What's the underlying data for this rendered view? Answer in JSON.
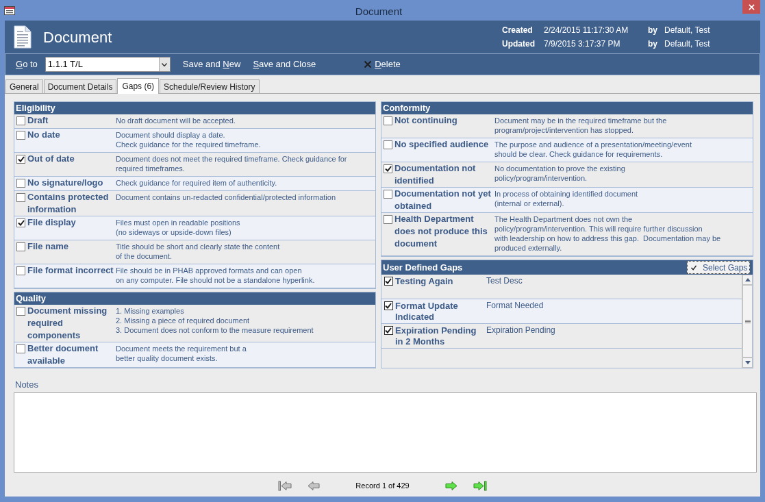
{
  "window": {
    "title": "Document"
  },
  "header": {
    "title": "Document",
    "audit": [
      {
        "label": "Created",
        "date": "2/24/2015 11:17:30 AM",
        "by": "by",
        "user": "Default, Test"
      },
      {
        "label": "Updated",
        "date": "7/9/2015 3:17:37 PM",
        "by": "by",
        "user": "Default, Test"
      }
    ]
  },
  "toolbar": {
    "goto": {
      "key": "G",
      "after": "o to",
      "value": "1.1.1 T/L"
    },
    "buttons": [
      {
        "kind": "plain",
        "before": "Save and ",
        "key": "N",
        "after": "ew"
      },
      {
        "kind": "plain",
        "key": "S",
        "after": "ave and Close"
      },
      {
        "kind": "delete",
        "key": "D",
        "after": "elete"
      }
    ]
  },
  "tabs": [
    {
      "label": "General",
      "selected": false
    },
    {
      "label": "Document Details",
      "selected": false
    },
    {
      "label": "Gaps (6)",
      "selected": true
    },
    {
      "label": "Schedule/Review History",
      "selected": false
    }
  ],
  "left_sections": [
    {
      "title": "Eligibility",
      "items": [
        {
          "label": "Draft",
          "description": "No draft document will be accepted.",
          "checked": false
        },
        {
          "label": "No date",
          "description": "Document should display a date.\nCheck guidance for the required timeframe.",
          "checked": false
        },
        {
          "label": "Out of date",
          "description": "Document does not meet the required timeframe. Check guidance for\nrequired timeframes.",
          "checked": true
        },
        {
          "label": "No signature/logo",
          "description": "Check guidance for required item of authenticity.",
          "checked": false
        },
        {
          "label": "Contains protected information",
          "description": "Document contains un-redacted confidential/protected information",
          "checked": false
        },
        {
          "label": "File display",
          "description": "Files must open in readable positions\n(no sideways or upside-down files)",
          "checked": true
        },
        {
          "label": "File name",
          "description": "Title should be short and clearly state the content\nof the document.",
          "checked": false
        },
        {
          "label": "File format incorrect",
          "description": "File should be in PHAB approved formats and can open\non any computer. File should not be a standalone hyperlink.",
          "checked": false
        }
      ]
    },
    {
      "title": "Quality",
      "items": [
        {
          "label": "Document missing required components",
          "description": "1. Missing examples\n2. Missing a piece of required document\n3. Document does not conform to the measure requirement",
          "checked": false
        },
        {
          "label": "Better document available",
          "description": "Document meets the requirement but a\nbetter quality document exists.",
          "checked": false
        }
      ]
    }
  ],
  "right_sections": [
    {
      "title": "Conformity",
      "items": [
        {
          "label": "Not continuing",
          "description": "Document may be in the required timeframe but the\nprogram/project/intervention has stopped.",
          "checked": false
        },
        {
          "label": "No specified audience",
          "description": "The purpose and audience of a presentation/meeting/event\nshould be clear. Check guidance for requirements.",
          "checked": false
        },
        {
          "label": "Documentation not identified",
          "description": "No documentation to prove the existing\npolicy/program/intervention.",
          "checked": true
        },
        {
          "label": "Documentation not yet obtained",
          "description": "In process of obtaining identified document\n(internal or external).",
          "checked": false
        },
        {
          "label": "Health Department does not produce this document",
          "description": "The Health Department does not own the\npolicy/program/intervention. This will require further discussion\nwith leadership on how to address this gap.  Documentation may be\nproduced externally.",
          "checked": false
        }
      ]
    }
  ],
  "user_defined_gaps": {
    "title": "User Defined Gaps",
    "select_button": "Select Gaps",
    "items": [
      {
        "label": "Testing Again",
        "description": "Test Desc",
        "checked": true
      },
      {
        "label": "Format Update Indicated",
        "description": "Format Needed",
        "checked": true
      },
      {
        "label": "Expiration Pending in 2 Months",
        "description": "Expiration Pending",
        "checked": true
      }
    ]
  },
  "notes": {
    "label": "Notes"
  },
  "navigation": {
    "record": "Record 1 of 429",
    "buttons": [
      {
        "kind": "first",
        "disabled": true
      },
      {
        "kind": "previous",
        "disabled": true
      },
      {
        "kind": "next",
        "disabled": false
      },
      {
        "kind": "last",
        "disabled": false
      }
    ]
  }
}
